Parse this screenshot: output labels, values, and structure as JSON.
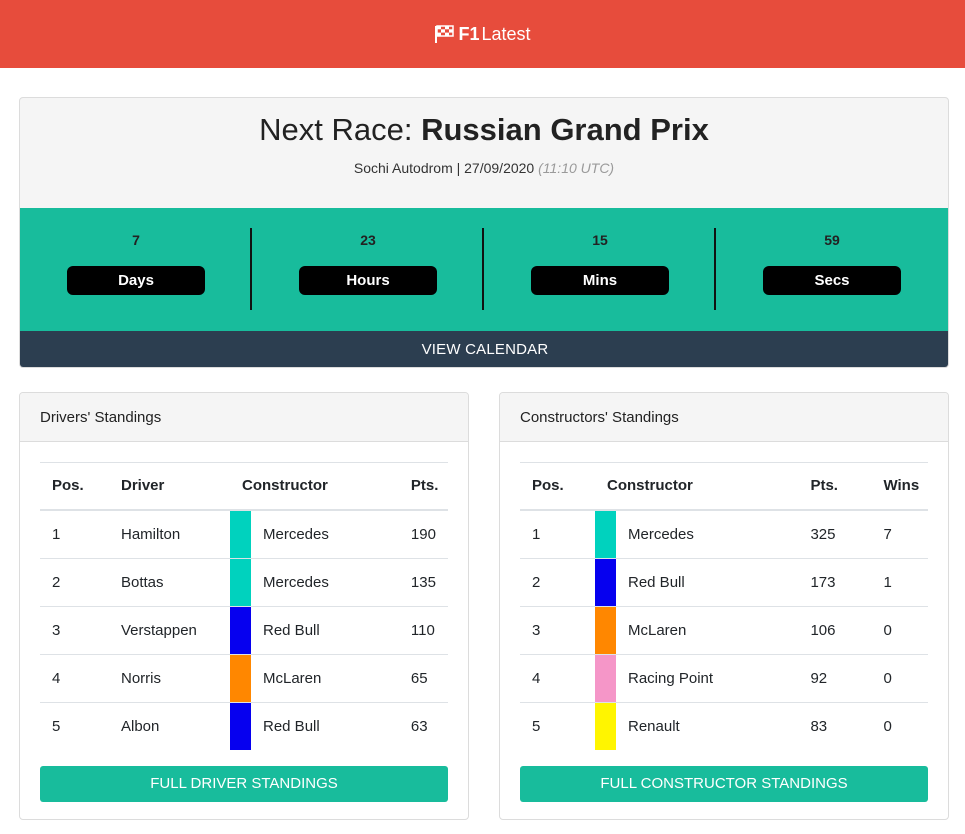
{
  "navbar": {
    "brand_bold": "F1",
    "brand_light": "Latest",
    "icon": "checkered-flag-icon"
  },
  "next_race": {
    "prefix": "Next Race: ",
    "name": "Russian Grand Prix",
    "location_date": "Sochi Autodrom | 27/09/2020",
    "time_utc": "(11:10 UTC)",
    "countdown": [
      {
        "value": "7",
        "label": "Days"
      },
      {
        "value": "23",
        "label": "Hours"
      },
      {
        "value": "15",
        "label": "Mins"
      },
      {
        "value": "59",
        "label": "Secs"
      }
    ],
    "calendar_button": "VIEW CALENDAR"
  },
  "drivers": {
    "title": "Drivers' Standings",
    "headers": {
      "pos": "Pos.",
      "driver": "Driver",
      "constructor": "Constructor",
      "pts": "Pts."
    },
    "rows": [
      {
        "pos": "1",
        "driver": "Hamilton",
        "constructor": "Mercedes",
        "color": "#00d2be",
        "pts": "190"
      },
      {
        "pos": "2",
        "driver": "Bottas",
        "constructor": "Mercedes",
        "color": "#00d2be",
        "pts": "135"
      },
      {
        "pos": "3",
        "driver": "Verstappen",
        "constructor": "Red Bull",
        "color": "#0600ef",
        "pts": "110"
      },
      {
        "pos": "4",
        "driver": "Norris",
        "constructor": "McLaren",
        "color": "#ff8700",
        "pts": "65"
      },
      {
        "pos": "5",
        "driver": "Albon",
        "constructor": "Red Bull",
        "color": "#0600ef",
        "pts": "63"
      }
    ],
    "button": "FULL DRIVER STANDINGS"
  },
  "constructors": {
    "title": "Constructors' Standings",
    "headers": {
      "pos": "Pos.",
      "constructor": "Constructor",
      "pts": "Pts.",
      "wins": "Wins"
    },
    "rows": [
      {
        "pos": "1",
        "constructor": "Mercedes",
        "color": "#00d2be",
        "pts": "325",
        "wins": "7"
      },
      {
        "pos": "2",
        "constructor": "Red Bull",
        "color": "#0600ef",
        "pts": "173",
        "wins": "1"
      },
      {
        "pos": "3",
        "constructor": "McLaren",
        "color": "#ff8700",
        "pts": "106",
        "wins": "0"
      },
      {
        "pos": "4",
        "constructor": "Racing Point",
        "color": "#f596c8",
        "pts": "92",
        "wins": "0"
      },
      {
        "pos": "5",
        "constructor": "Renault",
        "color": "#fff500",
        "pts": "83",
        "wins": "0"
      }
    ],
    "button": "FULL CONSTRUCTOR STANDINGS"
  }
}
